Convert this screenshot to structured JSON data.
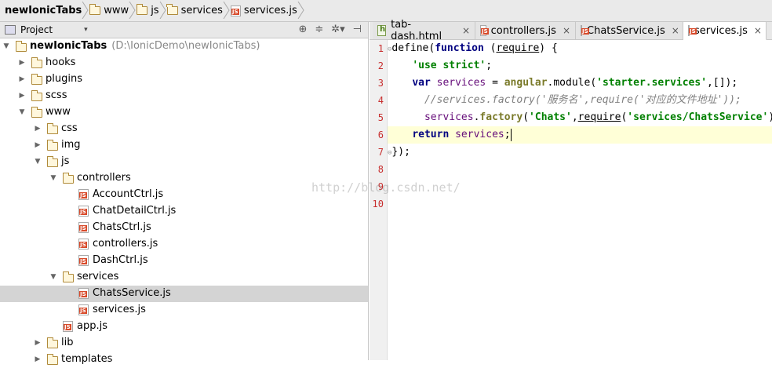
{
  "breadcrumb": [
    "newIonicTabs",
    "www",
    "js",
    "services",
    "services.js"
  ],
  "project": {
    "title": "Project",
    "tree": [
      {
        "label": "newIonicTabs",
        "path": "(D:\\IonicDemo\\newIonicTabs)",
        "type": "folder",
        "depth": 0,
        "expanded": true,
        "bold": true
      },
      {
        "label": "hooks",
        "type": "folder",
        "depth": 1,
        "expanded": false
      },
      {
        "label": "plugins",
        "type": "folder",
        "depth": 1,
        "expanded": false
      },
      {
        "label": "scss",
        "type": "folder",
        "depth": 1,
        "expanded": false
      },
      {
        "label": "www",
        "type": "folder",
        "depth": 1,
        "expanded": true
      },
      {
        "label": "css",
        "type": "folder",
        "depth": 2,
        "expanded": false
      },
      {
        "label": "img",
        "type": "folder",
        "depth": 2,
        "expanded": false
      },
      {
        "label": "js",
        "type": "folder",
        "depth": 2,
        "expanded": true
      },
      {
        "label": "controllers",
        "type": "folder",
        "depth": 3,
        "expanded": true
      },
      {
        "label": "AccountCtrl.js",
        "type": "js",
        "depth": 4
      },
      {
        "label": "ChatDetailCtrl.js",
        "type": "js",
        "depth": 4
      },
      {
        "label": "ChatsCtrl.js",
        "type": "js",
        "depth": 4
      },
      {
        "label": "controllers.js",
        "type": "js",
        "depth": 4
      },
      {
        "label": "DashCtrl.js",
        "type": "js",
        "depth": 4
      },
      {
        "label": "services",
        "type": "folder",
        "depth": 3,
        "expanded": true
      },
      {
        "label": "ChatsService.js",
        "type": "js",
        "depth": 4,
        "selected": true
      },
      {
        "label": "services.js",
        "type": "js",
        "depth": 4
      },
      {
        "label": "app.js",
        "type": "js",
        "depth": 3
      },
      {
        "label": "lib",
        "type": "folder",
        "depth": 2,
        "expanded": false
      },
      {
        "label": "templates",
        "type": "folder",
        "depth": 2,
        "expanded": false
      }
    ]
  },
  "tabs": [
    {
      "label": "tab-dash.html",
      "type": "html"
    },
    {
      "label": "controllers.js",
      "type": "js"
    },
    {
      "label": "ChatsService.js",
      "type": "js"
    },
    {
      "label": "services.js",
      "type": "js",
      "active": true
    }
  ],
  "editor": {
    "line_numbers": [
      "1",
      "2",
      "3",
      "4",
      "5",
      "6",
      "7",
      "8",
      "9",
      "10"
    ],
    "current_line": 6,
    "watermark": "http://blog.csdn.net/"
  }
}
